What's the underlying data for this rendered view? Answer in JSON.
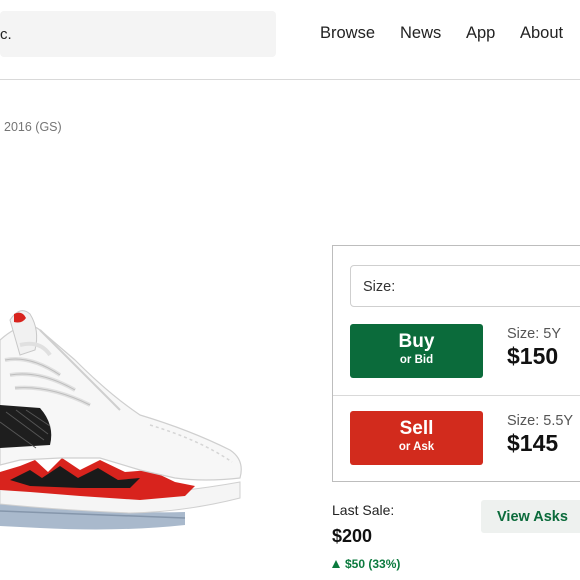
{
  "header": {
    "search_text": "c.",
    "nav": [
      "Browse",
      "News",
      "App",
      "About"
    ]
  },
  "product": {
    "subtitle": "2016 (GS)",
    "image_icon": "sneaker-image"
  },
  "purchase": {
    "size_label": "Size:",
    "buy": {
      "main": "Buy",
      "sub": "or Bid",
      "size": "Size: 5Y",
      "price": "$150"
    },
    "sell": {
      "main": "Sell",
      "sub": "or Ask",
      "size": "Size: 5.5Y",
      "price": "$145"
    }
  },
  "last_sale": {
    "label": "Last Sale:",
    "price": "$200",
    "change": "$50 (33%)"
  },
  "view_asks_label": "View Asks",
  "colors": {
    "buy_green": "#0b6b3b",
    "sell_red": "#d22b1d",
    "change_green": "#0b7a3e"
  }
}
